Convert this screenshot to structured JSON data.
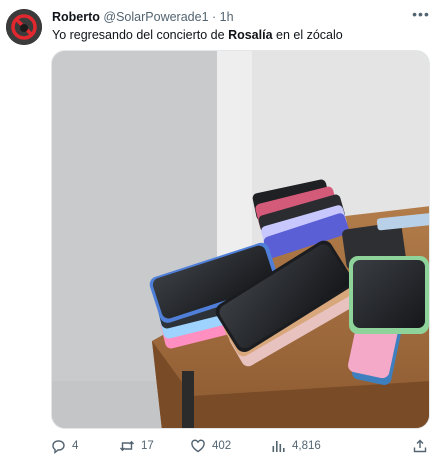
{
  "author": {
    "name": "Roberto",
    "handle": "@SolarPowerade1",
    "separator": "·",
    "time": "1h",
    "avatar_icon": "no-symbol-avatar-icon"
  },
  "tweet": {
    "text_prefix": "Yo regresando del concierto de ",
    "text_bold": "Rosalía",
    "text_suffix": " en el zócalo"
  },
  "media": {
    "description_icon": "photo-of-phones-on-table"
  },
  "actions": {
    "reply_count": "4",
    "retweet_count": "17",
    "like_count": "402",
    "views_count": "4,816"
  },
  "colors": {
    "text": "#0f1419",
    "secondary": "#536471",
    "border": "#e3e7ea"
  }
}
